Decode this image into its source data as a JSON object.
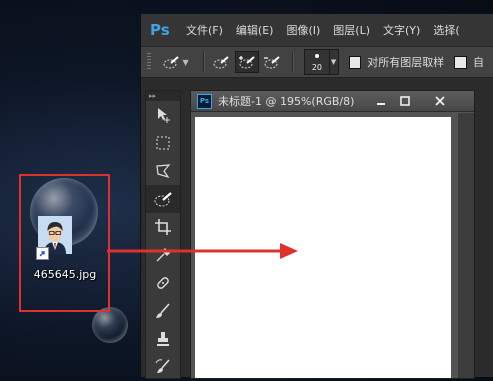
{
  "photoshop": {
    "logo": "Ps",
    "menu": [
      "文件(F)",
      "编辑(E)",
      "图像(I)",
      "图层(L)",
      "文字(Y)",
      "选择("
    ],
    "options_bar": {
      "brush_size": "20",
      "sample_all_layers_label": "对所有图层取样",
      "truncated_label": "自"
    },
    "document": {
      "badge": "Ps",
      "title": "未标题-1 @ 195%(RGB/8)"
    }
  },
  "desktop": {
    "file_icon_label": "465645.jpg"
  },
  "colors": {
    "highlight_border": "#e0302e",
    "arrow": "#e0302e",
    "ps_blue": "#3fa3e6"
  }
}
